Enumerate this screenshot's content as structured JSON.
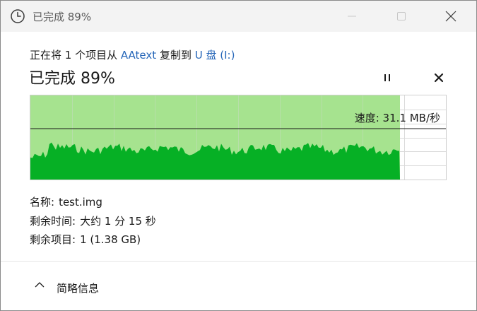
{
  "window": {
    "title": "已完成 89%",
    "icon": "clock-icon",
    "controls": [
      "minimize-icon",
      "maximize-icon",
      "close-icon"
    ]
  },
  "copy": {
    "prefix": "正在将 1 个项目从",
    "source": "AAtext",
    "middle": "复制到",
    "destination": "U 盘 (I:)"
  },
  "status": {
    "heading": "已完成 89%",
    "progress_percent": 89,
    "pause_icon": "pause-icon",
    "cancel_icon": "cancel-x-icon"
  },
  "graph": {
    "speed_text": "速度: 31.1 MB/秒",
    "colors": {
      "done_fill": "#a6e38f",
      "throughput_fill": "#06b025",
      "grid": "#d9d9d9",
      "speed_line": "#1a1a1a"
    }
  },
  "info": {
    "name_label": "名称:",
    "name_value": "test.img",
    "time_label": "剩余时间:",
    "time_value": "大约 1 分 15 秒",
    "items_label": "剩余项目:",
    "items_value": "1 (1.38 GB)"
  },
  "details": {
    "label": "简略信息",
    "icon": "chevron-up-icon"
  }
}
